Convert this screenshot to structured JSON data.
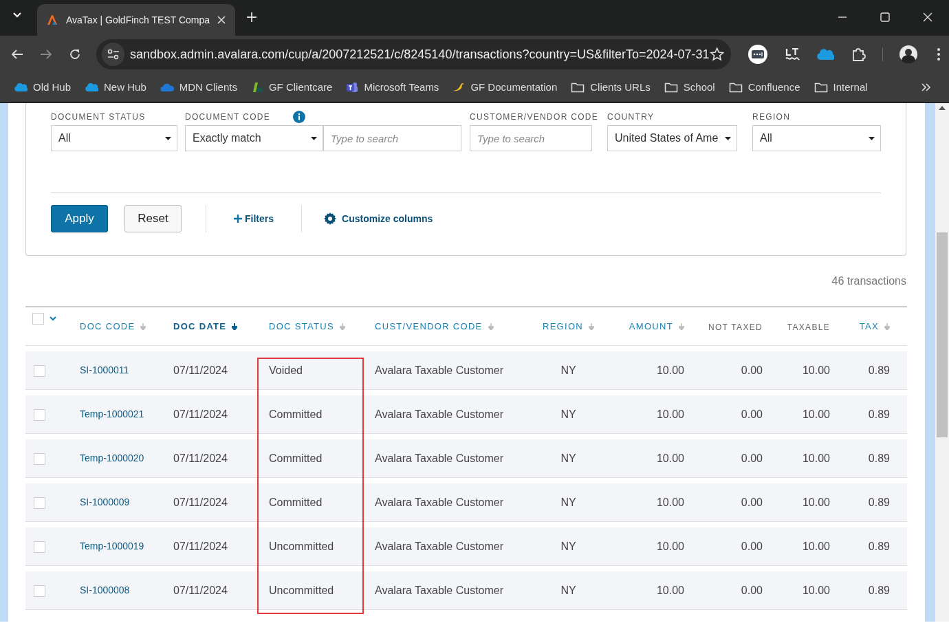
{
  "browser": {
    "tab_title": "AvaTax | GoldFinch TEST Compa",
    "url": "sandbox.admin.avalara.com/cup/a/2007212521/c/8245140/transactions?country=US&filterTo=2024-07-31",
    "bookmarks": [
      {
        "label": "Old Hub",
        "kind": "cloud"
      },
      {
        "label": "New Hub",
        "kind": "cloud"
      },
      {
        "label": "MDN Clients",
        "kind": "onedrive"
      },
      {
        "label": "GF Clientcare",
        "kind": "blocks"
      },
      {
        "label": "Microsoft Teams",
        "kind": "teams"
      },
      {
        "label": "GF Documentation",
        "kind": "bird"
      },
      {
        "label": "Clients URLs",
        "kind": "folder"
      },
      {
        "label": "School",
        "kind": "folder"
      },
      {
        "label": "Confluence",
        "kind": "folder"
      },
      {
        "label": "Internal",
        "kind": "folder"
      }
    ]
  },
  "filters": {
    "fields": [
      {
        "label": "DOCUMENT STATUS",
        "kind": "select",
        "value": "All"
      },
      {
        "label": "DOCUMENT CODE",
        "kind": "select-search",
        "value": "Exactly match",
        "placeholder": "Type to search",
        "info": true
      },
      {
        "label": "CUSTOMER/VENDOR CODE",
        "kind": "search",
        "placeholder": "Type to search"
      },
      {
        "label": "COUNTRY",
        "kind": "select",
        "value": "United States of Ame"
      },
      {
        "label": "REGION",
        "kind": "select",
        "value": "All"
      }
    ],
    "actions": [
      {
        "label": "Apply",
        "kind": "primary"
      },
      {
        "label": "Reset",
        "kind": "secondary"
      },
      {
        "label": "Filters",
        "kind": "add"
      },
      {
        "label": "Customize columns",
        "kind": "gear"
      }
    ]
  },
  "count": "46 transactions",
  "table": {
    "columns": [
      {
        "label": "DOC CODE",
        "sortable": true,
        "selected": false,
        "highlighted": false
      },
      {
        "label": "DOC DATE",
        "sortable": true,
        "selected": true,
        "highlighted": false
      },
      {
        "label": "DOC STATUS",
        "sortable": true,
        "selected": false,
        "highlighted": true
      },
      {
        "label": "CUST/VENDOR CODE",
        "sortable": true,
        "selected": false,
        "highlighted": false
      },
      {
        "label": "REGION",
        "sortable": true,
        "selected": false,
        "highlighted": false
      },
      {
        "label": "AMOUNT",
        "sortable": true,
        "selected": false,
        "highlighted": false
      },
      {
        "label": "NOT TAXED",
        "sortable": false,
        "selected": false,
        "highlighted": false
      },
      {
        "label": "TAXABLE",
        "sortable": false,
        "selected": false,
        "highlighted": false
      },
      {
        "label": "TAX",
        "sortable": true,
        "selected": false,
        "highlighted": false
      }
    ],
    "select_all_checked": false,
    "rows": [
      {
        "checked": false,
        "cells": [
          "SI-1000011",
          "07/11/2024",
          "Voided",
          "Avalara Taxable Customer",
          "NY",
          "10.00",
          "0.00",
          "10.00",
          "0.89"
        ]
      },
      {
        "checked": false,
        "cells": [
          "Temp-1000021",
          "07/11/2024",
          "Committed",
          "Avalara Taxable Customer",
          "NY",
          "10.00",
          "0.00",
          "10.00",
          "0.89"
        ]
      },
      {
        "checked": false,
        "cells": [
          "Temp-1000020",
          "07/11/2024",
          "Committed",
          "Avalara Taxable Customer",
          "NY",
          "10.00",
          "0.00",
          "10.00",
          "0.89"
        ]
      },
      {
        "checked": false,
        "cells": [
          "SI-1000009",
          "07/11/2024",
          "Committed",
          "Avalara Taxable Customer",
          "NY",
          "10.00",
          "0.00",
          "10.00",
          "0.89"
        ]
      },
      {
        "checked": false,
        "cells": [
          "Temp-1000019",
          "07/11/2024",
          "Uncommitted",
          "Avalara Taxable Customer",
          "NY",
          "10.00",
          "0.00",
          "10.00",
          "0.89"
        ]
      },
      {
        "checked": false,
        "cells": [
          "SI-1000008",
          "07/11/2024",
          "Uncommitted",
          "Avalara Taxable Customer",
          "NY",
          "10.00",
          "0.00",
          "10.00",
          "0.89"
        ]
      }
    ]
  }
}
